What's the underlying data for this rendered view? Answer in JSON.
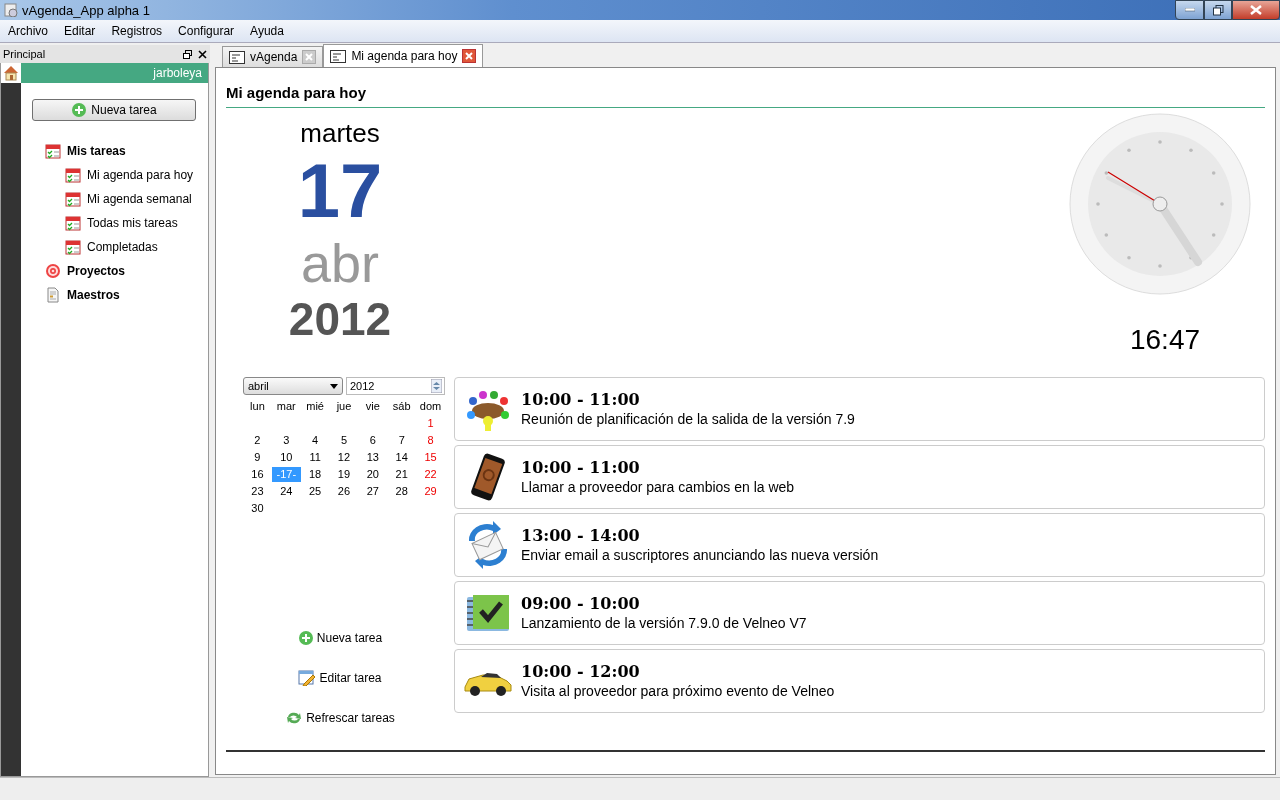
{
  "window": {
    "title": "vAgenda_App alpha 1"
  },
  "menu": [
    "Archivo",
    "Editar",
    "Registros",
    "Configurar",
    "Ayuda"
  ],
  "dock": {
    "title": "Principal",
    "user": "jarboleya",
    "new_task_button": "Nueva tarea",
    "tree": [
      {
        "label": "Mis tareas",
        "kind": "tasks",
        "children": [
          {
            "label": "Mi agenda para hoy",
            "kind": "tasks"
          },
          {
            "label": "Mi agenda semanal",
            "kind": "tasks"
          },
          {
            "label": "Todas mis tareas",
            "kind": "tasks"
          },
          {
            "label": "Completadas",
            "kind": "tasks"
          }
        ]
      },
      {
        "label": "Proyectos",
        "kind": "projects"
      },
      {
        "label": "Maestros",
        "kind": "masters"
      }
    ]
  },
  "tabs": [
    {
      "label": "vAgenda",
      "selected": false
    },
    {
      "label": "Mi agenda para hoy",
      "selected": true
    }
  ],
  "page": {
    "heading": "Mi agenda para hoy",
    "day_name": "martes",
    "day": "17",
    "month": "abr",
    "year": "2012",
    "time": "16:47",
    "calendar": {
      "month_select": "abril",
      "year_field": "2012",
      "weekdays": [
        "lun",
        "mar",
        "mié",
        "jue",
        "vie",
        "sáb",
        "dom"
      ],
      "weeks": [
        [
          {
            "label": "1",
            "kind": "sunday",
            "selected": false
          }
        ],
        [
          {
            "label": "2",
            "kind": "weekday",
            "selected": false
          },
          {
            "label": "3",
            "kind": "weekday",
            "selected": false
          },
          {
            "label": "4",
            "kind": "weekday",
            "selected": false
          },
          {
            "label": "5",
            "kind": "weekday",
            "selected": false
          },
          {
            "label": "6",
            "kind": "weekday",
            "selected": false
          },
          {
            "label": "7",
            "kind": "weekday",
            "selected": false
          },
          {
            "label": "8",
            "kind": "sunday",
            "selected": false
          }
        ],
        [
          {
            "label": "9",
            "kind": "weekday",
            "selected": false
          },
          {
            "label": "10",
            "kind": "weekday",
            "selected": false
          },
          {
            "label": "11",
            "kind": "weekday",
            "selected": false
          },
          {
            "label": "12",
            "kind": "weekday",
            "selected": false
          },
          {
            "label": "13",
            "kind": "weekday",
            "selected": false
          },
          {
            "label": "14",
            "kind": "weekday",
            "selected": false
          },
          {
            "label": "15",
            "kind": "sunday",
            "selected": false
          }
        ],
        [
          {
            "label": "16",
            "kind": "weekday",
            "selected": false
          },
          {
            "label": "-17-",
            "kind": "weekday",
            "selected": true
          },
          {
            "label": "18",
            "kind": "weekday",
            "selected": false
          },
          {
            "label": "19",
            "kind": "weekday",
            "selected": false
          },
          {
            "label": "20",
            "kind": "weekday",
            "selected": false
          },
          {
            "label": "21",
            "kind": "weekday",
            "selected": false
          },
          {
            "label": "22",
            "kind": "sunday",
            "selected": false
          }
        ],
        [
          {
            "label": "23",
            "kind": "weekday",
            "selected": false
          },
          {
            "label": "24",
            "kind": "weekday",
            "selected": false
          },
          {
            "label": "25",
            "kind": "weekday",
            "selected": false
          },
          {
            "label": "26",
            "kind": "weekday",
            "selected": false
          },
          {
            "label": "27",
            "kind": "weekday",
            "selected": false
          },
          {
            "label": "28",
            "kind": "weekday",
            "selected": false
          },
          {
            "label": "29",
            "kind": "sunday",
            "selected": false
          }
        ],
        [
          {
            "label": "30",
            "kind": "weekday",
            "selected": false
          }
        ]
      ]
    },
    "actions": [
      {
        "label": "Nueva tarea",
        "kind": "add"
      },
      {
        "label": "Editar tarea",
        "kind": "edit"
      },
      {
        "label": "Refrescar tareas",
        "kind": "refresh"
      }
    ],
    "tasks": [
      {
        "time": "10:00 - 11:00",
        "title": "Reunión de planificación de la salida de la versión 7.9",
        "kind": "meeting"
      },
      {
        "time": "10:00 - 11:00",
        "title": "Llamar a proveedor para cambios en la web",
        "kind": "phone"
      },
      {
        "time": "13:00 - 14:00",
        "title": "Enviar email a suscriptores anunciando las nueva versión",
        "kind": "email"
      },
      {
        "time": "09:00 - 10:00",
        "title": "Lanzamiento de la versión 7.9.0 de Velneo V7",
        "kind": "launch"
      },
      {
        "time": "10:00 - 12:00",
        "title": "Visita al proveedor para próximo evento de Velneo",
        "kind": "car"
      }
    ]
  }
}
